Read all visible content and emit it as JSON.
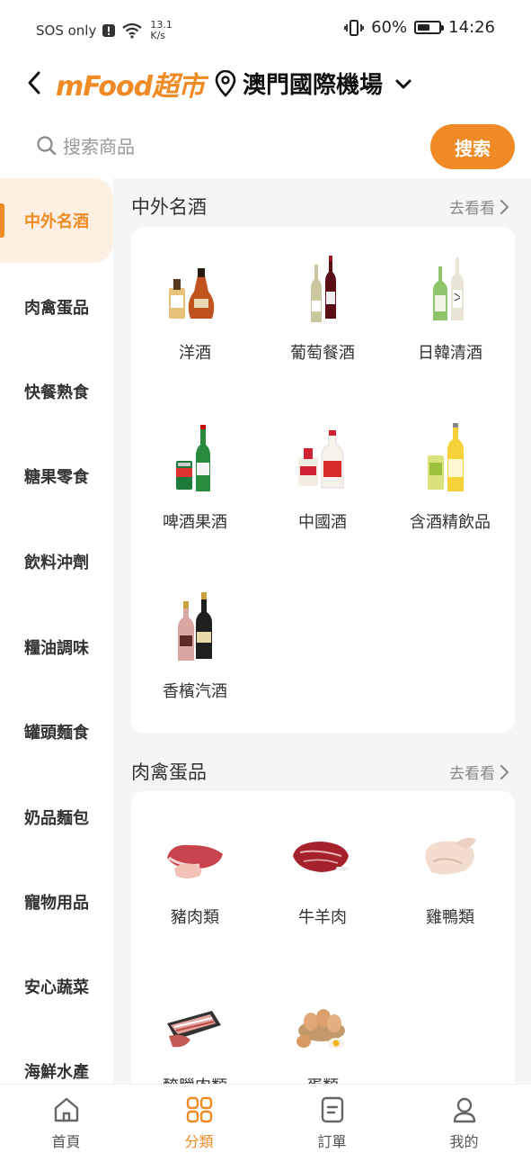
{
  "status_bar": {
    "carrier": "SOS only",
    "net_speed_value": "13.1",
    "net_speed_unit": "K/s",
    "battery": "60%",
    "time": "14:26",
    "battery_level": 0.6
  },
  "header": {
    "brand": "mFood超市",
    "location": "澳門國際機場"
  },
  "search": {
    "placeholder": "搜索商品",
    "button": "搜索"
  },
  "sidebar": {
    "items": [
      {
        "label": "中外名酒",
        "active": true
      },
      {
        "label": "肉禽蛋品"
      },
      {
        "label": "快餐熟食"
      },
      {
        "label": "糖果零食"
      },
      {
        "label": "飲料沖劑"
      },
      {
        "label": "糧油調味"
      },
      {
        "label": "罐頭麵食"
      },
      {
        "label": "奶品麵包"
      },
      {
        "label": "寵物用品"
      },
      {
        "label": "安心蔬菜"
      },
      {
        "label": "海鮮水產"
      }
    ]
  },
  "sections": [
    {
      "title": "中外名酒",
      "more": "去看看",
      "items": [
        {
          "label": "洋酒",
          "icon": "cognac-bottle-icon"
        },
        {
          "label": "葡萄餐酒",
          "icon": "wine-bottles-icon"
        },
        {
          "label": "日韓清酒",
          "icon": "sake-bottles-icon"
        },
        {
          "label": "啤酒果酒",
          "icon": "beer-bottle-icon"
        },
        {
          "label": "中國酒",
          "icon": "baijiu-bottle-icon"
        },
        {
          "label": "含酒精飲品",
          "icon": "alcopop-bottle-icon"
        },
        {
          "label": "香檳汽酒",
          "icon": "champagne-bottles-icon"
        }
      ]
    },
    {
      "title": "肉禽蛋品",
      "more": "去看看",
      "items": [
        {
          "label": "豬肉類",
          "icon": "pork-icon"
        },
        {
          "label": "牛羊肉",
          "icon": "beef-icon"
        },
        {
          "label": "雞鴨類",
          "icon": "chicken-icon"
        },
        {
          "label": "醃臘肉類",
          "icon": "bacon-icon"
        },
        {
          "label": "蛋類",
          "icon": "eggs-icon"
        }
      ]
    }
  ],
  "bottom_nav": [
    {
      "label": "首頁",
      "icon": "home-icon"
    },
    {
      "label": "分類",
      "icon": "category-icon",
      "active": true
    },
    {
      "label": "訂單",
      "icon": "orders-icon"
    },
    {
      "label": "我的",
      "icon": "profile-icon"
    }
  ],
  "colors": {
    "accent": "#F08A25",
    "active_bg": "#FDEFE1",
    "panel_bg": "#F4F5F7"
  }
}
